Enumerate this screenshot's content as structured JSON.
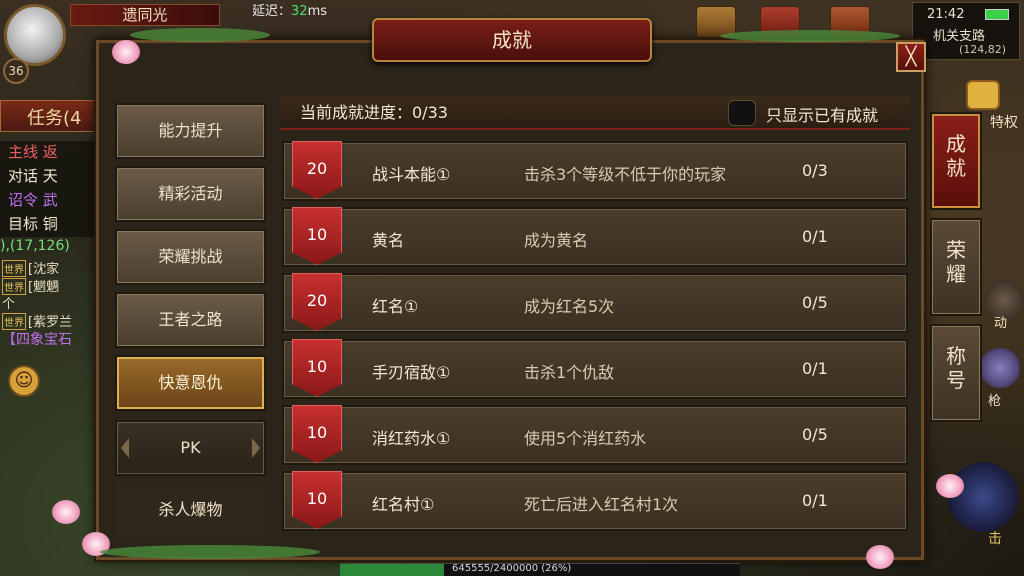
{
  "hud": {
    "player_name": "遗同光",
    "level": "36",
    "latency_label": "延迟：",
    "latency_value": "32",
    "latency_unit": "ms",
    "time": "21:42",
    "location": "机关支路",
    "coords": "(124,82)",
    "privilege": "特权",
    "task_tab": "任务(4",
    "task_rows": [
      {
        "a": "主线",
        "b": "返"
      },
      {
        "a": "对话",
        "b": "天"
      },
      {
        "a": "诏令",
        "b": "武"
      },
      {
        "a": "目标",
        "b": "铜"
      }
    ],
    "map_coords": "),(17,126)",
    "chat": [
      {
        "tag": "世界",
        "text": "[沈家"
      },
      {
        "tag": "世界",
        "text": "[魍魉"
      },
      {
        "tag": "",
        "text": "个"
      },
      {
        "tag": "世界",
        "text": "[紫罗兰"
      }
    ],
    "chat_item": "【四象宝石",
    "exp_text": "645555/2400000 (26%)",
    "exp_fraction": 0.26,
    "right_labels": [
      "动",
      "枪",
      "击"
    ]
  },
  "panel": {
    "title": "成就",
    "close_label": "╳",
    "progress_label": "当前成就进度：0/33",
    "filter_label": "只显示已有成就",
    "categories": [
      {
        "label": "能力提升",
        "state": "normal"
      },
      {
        "label": "精彩活动",
        "state": "normal"
      },
      {
        "label": "荣耀挑战",
        "state": "normal"
      },
      {
        "label": "王者之路",
        "state": "normal"
      },
      {
        "label": "快意恩仇",
        "state": "active"
      },
      {
        "label": "PK",
        "state": "sub"
      },
      {
        "label": "杀人爆物",
        "state": "flat"
      }
    ],
    "achievements": [
      {
        "points": "20",
        "name": "战斗本能①",
        "desc": "击杀3个等级不低于你的玩家",
        "progress": "0/3"
      },
      {
        "points": "10",
        "name": "黄名",
        "desc": "成为黄名",
        "progress": "0/1"
      },
      {
        "points": "20",
        "name": "红名①",
        "desc": "成为红名5次",
        "progress": "0/5"
      },
      {
        "points": "10",
        "name": "手刃宿敌①",
        "desc": "击杀1个仇敌",
        "progress": "0/1"
      },
      {
        "points": "10",
        "name": "消红药水①",
        "desc": "使用5个消红药水",
        "progress": "0/5"
      },
      {
        "points": "10",
        "name": "红名村①",
        "desc": "死亡后进入红名村1次",
        "progress": "0/1"
      }
    ],
    "side_tabs": [
      {
        "label1": "成",
        "label2": "就",
        "active": true
      },
      {
        "label1": "荣",
        "label2": "耀",
        "active": false
      },
      {
        "label1": "称",
        "label2": "号",
        "active": false
      }
    ]
  },
  "colors": {
    "accent": "#8a1818",
    "badge": "#c83030",
    "active_tab": "#9a6a2a",
    "latency_green": "#4ee06a"
  }
}
